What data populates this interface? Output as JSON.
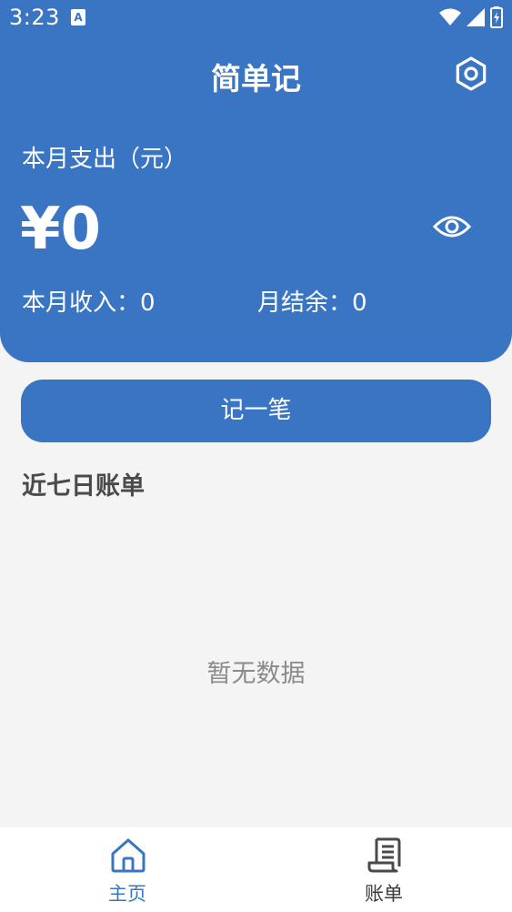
{
  "status_bar": {
    "time": "3:23",
    "a_badge": "A"
  },
  "header": {
    "title": "简单记",
    "month_expense_label": "本月支出（元）",
    "expense_amount": "¥0",
    "month_income": "本月收入：0",
    "month_balance": "月结余：0"
  },
  "actions": {
    "record_button": "记一笔"
  },
  "recent": {
    "section_title": "近七日账单",
    "empty_text": "暂无数据"
  },
  "bottom_nav": {
    "items": [
      {
        "label": "主页",
        "icon": "home-icon",
        "active": true
      },
      {
        "label": "账单",
        "icon": "bill-icon",
        "active": false
      }
    ]
  },
  "colors": {
    "primary": "#3a75c4",
    "background": "#f4f4f5",
    "nav_background": "#ffffff",
    "muted_text": "#8a8a8a"
  }
}
